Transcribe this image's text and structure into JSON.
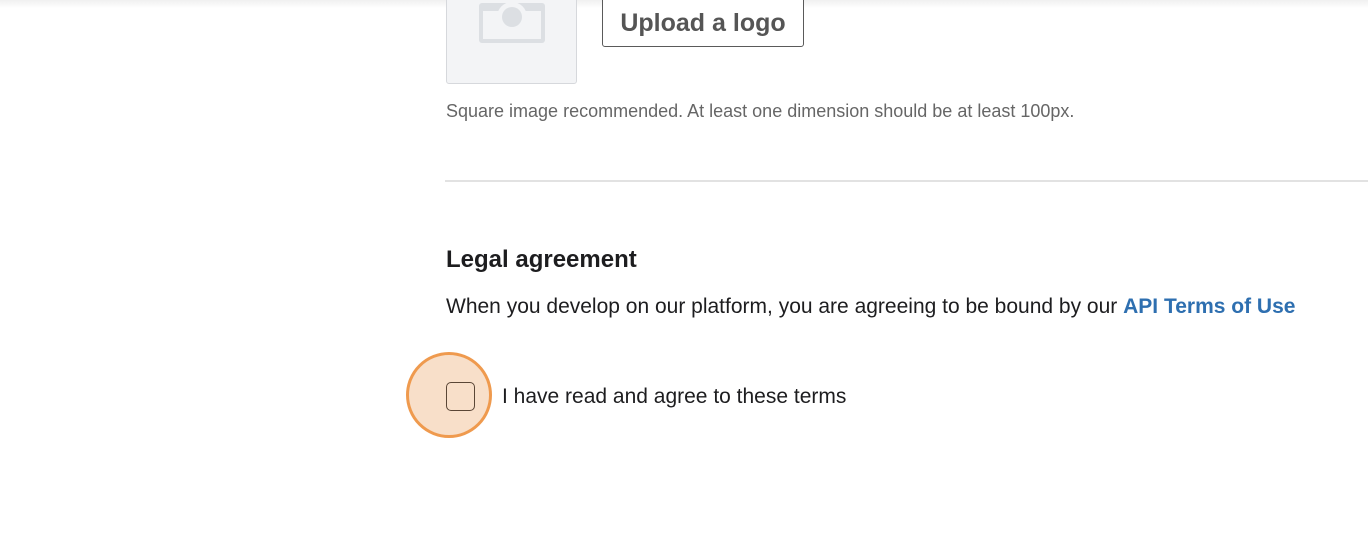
{
  "logo": {
    "upload_label": "Upload a logo",
    "hint": "Square image recommended. At least one dimension should be at least 100px."
  },
  "legal": {
    "heading": "Legal agreement",
    "text": "When you develop on our platform, you are agreeing to be bound by our ",
    "link": "API Terms of Use",
    "checkbox_label": "I have read and agree to these terms",
    "checked": false
  },
  "colors": {
    "link": "#2e6fb0",
    "highlight_ring": "#ef9a4e"
  }
}
